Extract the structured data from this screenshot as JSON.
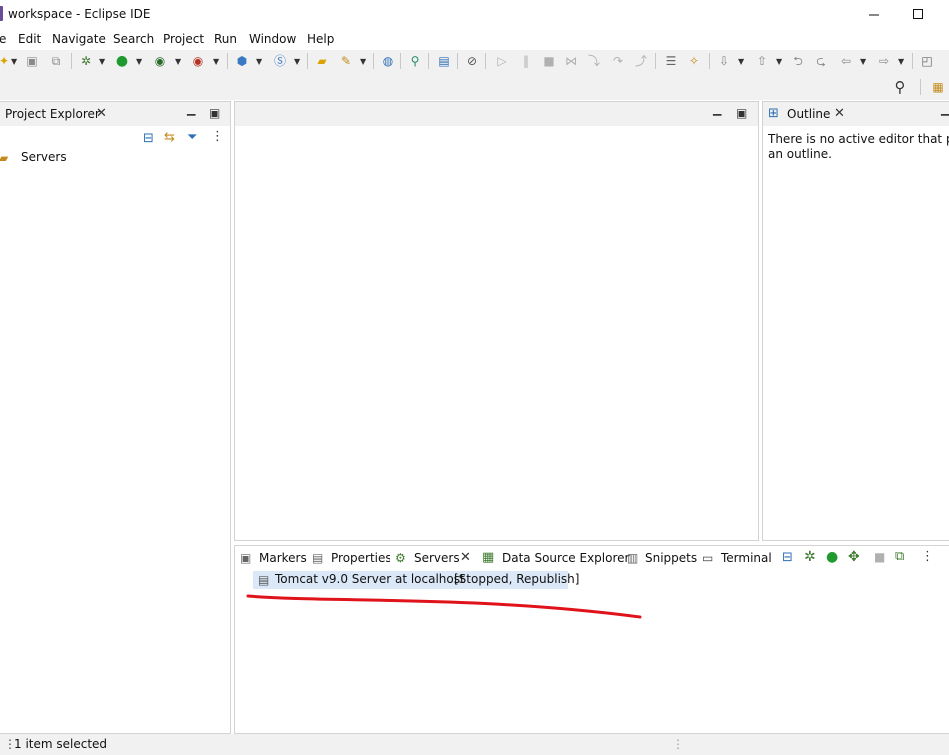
{
  "window": {
    "title": "workspace - Eclipse IDE"
  },
  "menu": [
    "e",
    "Edit",
    "Navigate",
    "Search",
    "Project",
    "Run",
    "Window",
    "Help"
  ],
  "project_explorer": {
    "tab_label": "Project Explorer",
    "tree": [
      {
        "label": "Servers",
        "icon": "folder-open-icon"
      }
    ]
  },
  "outline": {
    "tab_label": "Outline",
    "message_line1": "There is no active editor that prov",
    "message_line2": "an outline."
  },
  "bottom_panel": {
    "tabs": [
      "Markers",
      "Properties",
      "Servers",
      "Data Source Explorer",
      "Snippets",
      "Terminal"
    ],
    "active_tab": "Servers",
    "server_row": {
      "name": "Tomcat v9.0 Server at localhost",
      "status": "[Stopped, Republish]"
    }
  },
  "status": {
    "text": "1 item selected"
  },
  "colors": {
    "annotation": "#e0121a",
    "selection": "#dbe8f7",
    "panel_bg": "#f1f1f1"
  }
}
